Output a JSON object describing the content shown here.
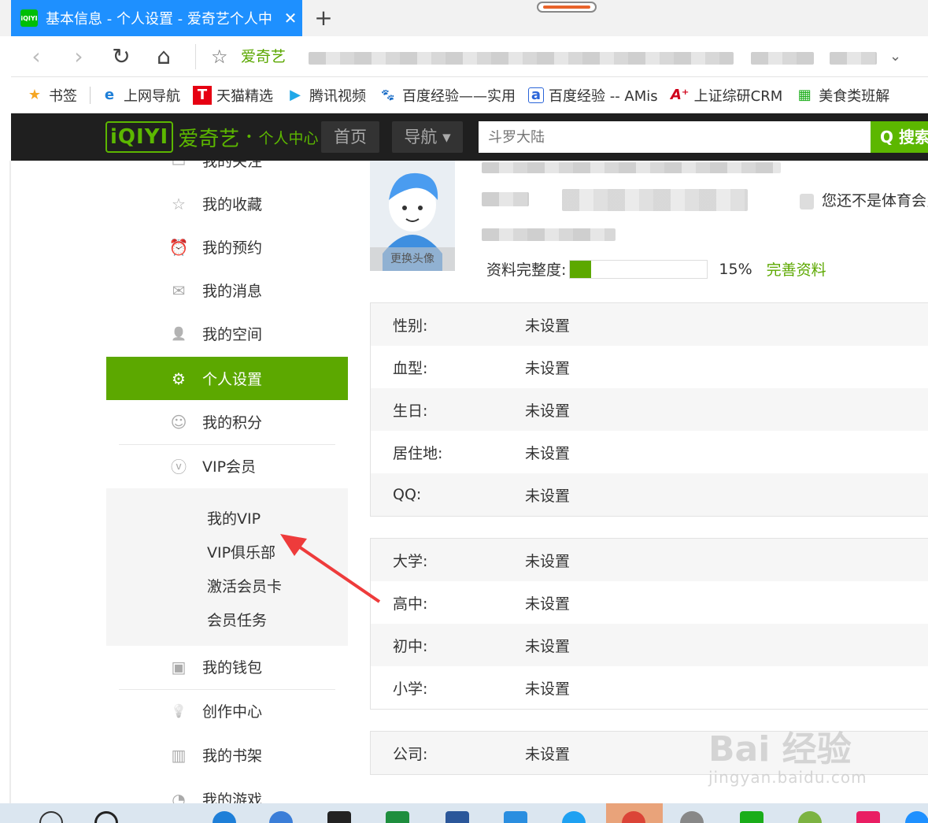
{
  "browser": {
    "tab_title": "基本信息 - 个人设置 - 爱奇艺个人中",
    "tab_favicon": "iQIYI",
    "tab_close": "✕",
    "new_tab": "+",
    "back_icon": "‹",
    "forward_icon": "›",
    "reload_icon": "↻",
    "home_icon": "⌂",
    "star_icon": "☆",
    "site_name": "爱奇艺",
    "dropdown_icon": "⌄"
  },
  "bookmarks": [
    {
      "label": "书签",
      "icon": "★",
      "color": "#f5a623"
    },
    {
      "label": "上网导航",
      "icon": "e",
      "color": "#1e7fd8"
    },
    {
      "label": "天猫精选",
      "icon": "T",
      "color": "#e60012"
    },
    {
      "label": "腾讯视频",
      "icon": "▶",
      "color": "#20a8e8"
    },
    {
      "label": "百度经验——实用",
      "icon": "🐾",
      "color": "#2b65d9"
    },
    {
      "label": "百度经验 -- AMis",
      "icon": "a",
      "color": "#2b65d9"
    },
    {
      "label": "上证综研CRM",
      "icon": "A⁺",
      "color": "#d0021b"
    },
    {
      "label": "美食类班解",
      "icon": "▦",
      "color": "#1aad19"
    }
  ],
  "header": {
    "logo_mark": "iQIYI",
    "logo_brand": "爱奇艺",
    "logo_dot": "•",
    "logo_sub": "个人中心",
    "nav_home": "首页",
    "nav_guide": "导航 ▾",
    "search_placeholder": "斗罗大陆",
    "search_button": "Q 搜索"
  },
  "sidebar": {
    "items": [
      {
        "label": "我的收藏",
        "icon": "☆"
      },
      {
        "label": "我的预约",
        "icon": "⏰"
      },
      {
        "label": "我的消息",
        "icon": "✉"
      },
      {
        "label": "我的空间",
        "icon": "👤"
      },
      {
        "label": "个人设置",
        "icon": "⚙"
      },
      {
        "label": "我的积分",
        "icon": "☺"
      },
      {
        "label": "VIP会员",
        "icon": "ⓥ"
      },
      {
        "label": "我的钱包",
        "icon": "▣"
      },
      {
        "label": "创作中心",
        "icon": "💡"
      },
      {
        "label": "我的书架",
        "icon": "▥"
      },
      {
        "label": "我的游戏",
        "icon": "◔"
      }
    ],
    "vip_sub": [
      "我的VIP",
      "VIP俱乐部",
      "激活会员卡",
      "会员任务"
    ],
    "top_partial": "我的关注"
  },
  "profile": {
    "avatar_edit": "更换头像",
    "not_sports_member": "您还不是体育会员",
    "completeness_label": "资料完整度:",
    "completeness_value": 15,
    "completeness_text": "15%",
    "complete_link": "完善资料"
  },
  "info_blocks": [
    [
      {
        "label": "性别:",
        "value": "未设置"
      },
      {
        "label": "血型:",
        "value": "未设置"
      },
      {
        "label": "生日:",
        "value": "未设置"
      },
      {
        "label": "居住地:",
        "value": "未设置"
      },
      {
        "label": "QQ:",
        "value": "未设置"
      }
    ],
    [
      {
        "label": "大学:",
        "value": "未设置"
      },
      {
        "label": "高中:",
        "value": "未设置"
      },
      {
        "label": "初中:",
        "value": "未设置"
      },
      {
        "label": "小学:",
        "value": "未设置"
      }
    ],
    [
      {
        "label": "公司:",
        "value": "未设置"
      }
    ]
  ],
  "watermark": {
    "main": "Bai 经验",
    "sub": "jingyan.baidu.com"
  },
  "colors": {
    "accent": "#5ca800",
    "tab": "#1e90ff",
    "header": "#1f1f1f"
  }
}
